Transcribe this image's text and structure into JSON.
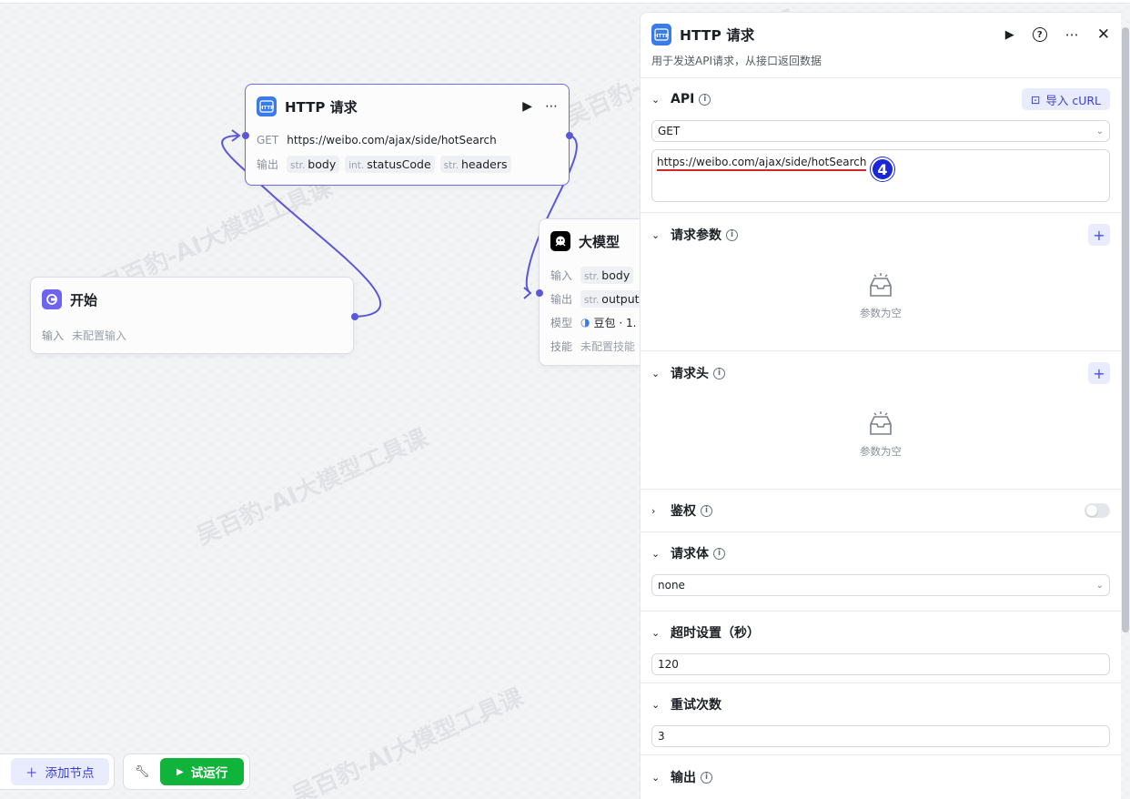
{
  "watermark_text": "吴百豹-AI大模型工具课",
  "canvas": {
    "http_node": {
      "title": "HTTP 请求",
      "method": "GET",
      "url": "https://weibo.com/ajax/side/hotSearch",
      "output_label": "输出",
      "outputs": [
        {
          "type": "str.",
          "name": "body"
        },
        {
          "type": "int.",
          "name": "statusCode"
        },
        {
          "type": "str.",
          "name": "headers"
        }
      ]
    },
    "start_node": {
      "title": "开始",
      "input_label": "输入",
      "input_value": "未配置输入"
    },
    "llm_node": {
      "title": "大模型",
      "input_label": "输入",
      "input_tag": {
        "type": "str.",
        "name": "body"
      },
      "output_label": "输出",
      "output_tag": {
        "type": "str.",
        "name": "output"
      },
      "model_label": "模型",
      "model_value": "豆包 · 1.",
      "skill_label": "技能",
      "skill_value": "未配置技能"
    }
  },
  "toolbar": {
    "add_node_label": "添加节点",
    "run_label": "试运行"
  },
  "panel": {
    "title": "HTTP 请求",
    "description": "用于发送API请求，从接口返回数据",
    "api": {
      "title": "API",
      "import_label": "导入 cURL",
      "method": "GET",
      "url": "https://weibo.com/ajax/side/hotSearch",
      "badge": "4"
    },
    "params": {
      "title": "请求参数",
      "empty": "参数为空"
    },
    "headers": {
      "title": "请求头",
      "empty": "参数为空"
    },
    "auth": {
      "title": "鉴权",
      "enabled": false
    },
    "body": {
      "title": "请求体",
      "value": "none"
    },
    "timeout": {
      "title": "超时设置（秒）",
      "value": "120"
    },
    "retry": {
      "title": "重试次数",
      "value": "3"
    },
    "output": {
      "title": "输出"
    }
  },
  "colors": {
    "accent": "#5a58d6",
    "run_green": "#11b43b",
    "http_icon_blue": "#3a7bea",
    "badge_blue": "#1a26d9",
    "underline_red": "#d0272c"
  }
}
